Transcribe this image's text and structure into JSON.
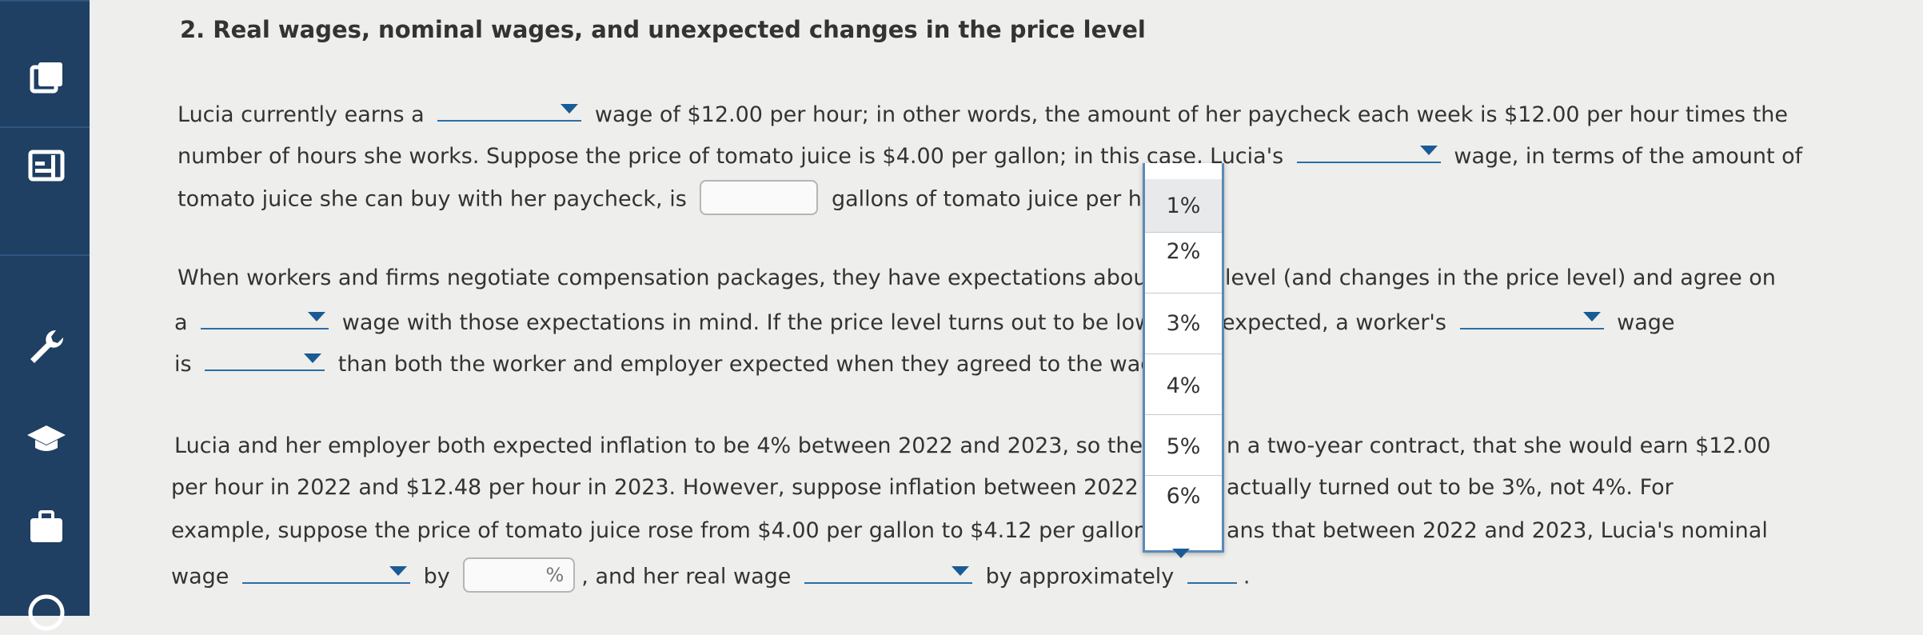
{
  "title": "2. Real wages, nominal wages, and unexpected changes in the price level",
  "sidebar": {
    "icons": [
      "book-icon",
      "layout-icon",
      "wrench-icon",
      "graduation-cap-icon",
      "briefcase-icon",
      "help-icon"
    ]
  },
  "p1": {
    "l1a": "Lucia currently earns a",
    "l1b": "wage of $12.00 per hour; in other words, the amount of her paycheck each week is $12.00 per hour times the",
    "l2a": "number of hours she works. Suppose the price of tomato juice is $4.00 per gallon; in this case, Lucia's",
    "l2b": "wage, in terms of the amount of",
    "l3a": "tomato juice she can buy with her paycheck, is",
    "l3b": "gallons of tomato juice per hour."
  },
  "p2": {
    "l1a": "When workers and firms negotiate compensation packages, they have expectations about th",
    "l1b": "level (and changes in the price level) and agree on",
    "l2a": "a",
    "l2b": "wage with those expectations in mind. If the price level turns out to be lowe",
    "l2c": "expected, a worker's",
    "l2d": "wage",
    "l3a": "is",
    "l3b": "than both the worker and employer expected when they agreed to the wage."
  },
  "p3": {
    "l1a": "Lucia and her employer both expected inflation to be 4% between 2022 and 2023, so they a",
    "l1b": "n a two-year contract, that she would earn $12.00",
    "l2a": "per hour in 2022 and $12.48 per hour in 2023. However, suppose inflation between 2022 ar",
    "l2b": "actually turned out to be 3%, not 4%. For",
    "l3a": "example, suppose the price of tomato juice rose from $4.00 per gallon to $4.12 per gallon.",
    "l3b": "ans that between 2022 and 2023, Lucia's nominal",
    "l4a": "wage",
    "l4b": "by",
    "l4c": ", and her real wage",
    "l4d": "by approximately",
    "l4e": ".",
    "percent_unit": "%"
  },
  "dropdown": {
    "options": [
      "1%",
      "2%",
      "3%",
      "4%",
      "5%",
      "6%"
    ],
    "highlighted": "1%"
  },
  "colors": {
    "sidebar": "#1f3f63",
    "accent": "#1a5b96",
    "background": "#eeeeec"
  }
}
